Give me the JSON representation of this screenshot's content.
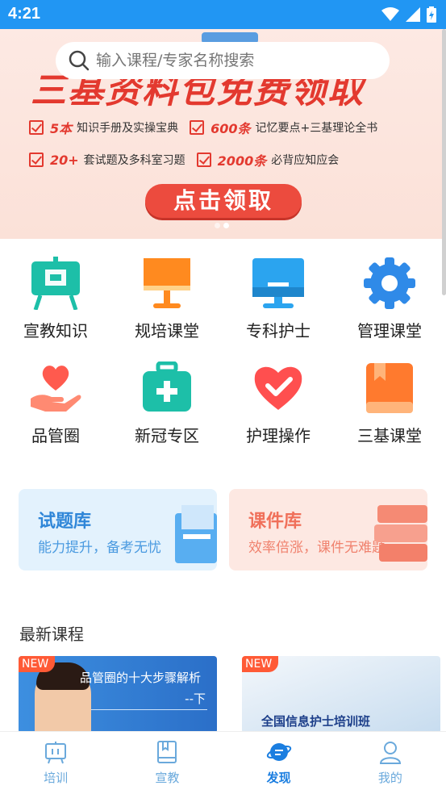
{
  "status": {
    "time": "4:21"
  },
  "search": {
    "placeholder": "输入课程/专家名称搜索"
  },
  "banner": {
    "headline": "三基资料包免费领取",
    "rows": [
      {
        "a_num": "5本",
        "a_text": "知识手册及实操宝典",
        "b_num": "600条",
        "b_text": "记忆要点+三基理论全书"
      },
      {
        "a_num": "20+",
        "a_text": "套试题及多科室习题",
        "b_num": "2000条",
        "b_text": "必背应知应会"
      }
    ],
    "cta": "点击领取"
  },
  "grid": [
    {
      "label": "宣教知识",
      "icon": "easel-icon",
      "color": "#1dbfa8"
    },
    {
      "label": "规培课堂",
      "icon": "lamp-icon",
      "color": "#ff8a1f"
    },
    {
      "label": "专科护士",
      "icon": "monitor-icon",
      "color": "#2ba4ef"
    },
    {
      "label": "管理课堂",
      "icon": "gear-icon",
      "color": "#2f8ae8"
    },
    {
      "label": "品管圈",
      "icon": "heart-hand-icon",
      "color": "#ff5a4e"
    },
    {
      "label": "新冠专区",
      "icon": "medkit-icon",
      "color": "#1dbfa8"
    },
    {
      "label": "护理操作",
      "icon": "heart-check-icon",
      "color": "#ff4f4f"
    },
    {
      "label": "三基课堂",
      "icon": "book-icon",
      "color": "#ff7a2e"
    }
  ],
  "cards": [
    {
      "title": "试题库",
      "subtitle": "能力提升，备考无忧"
    },
    {
      "title": "课件库",
      "subtitle": "效率倍涨，课件无难题"
    }
  ],
  "latest": {
    "title": "最新课程",
    "items": [
      {
        "tag": "NEW",
        "title": "品管圈的十大步骤解析",
        "sub": "--下"
      },
      {
        "tag": "NEW",
        "title": "全国信息护士培训班"
      }
    ]
  },
  "tabs": [
    {
      "label": "培训",
      "icon": "training-icon"
    },
    {
      "label": "宣教",
      "icon": "book-icon"
    },
    {
      "label": "发现",
      "icon": "planet-icon",
      "active": true
    },
    {
      "label": "我的",
      "icon": "user-icon"
    }
  ]
}
